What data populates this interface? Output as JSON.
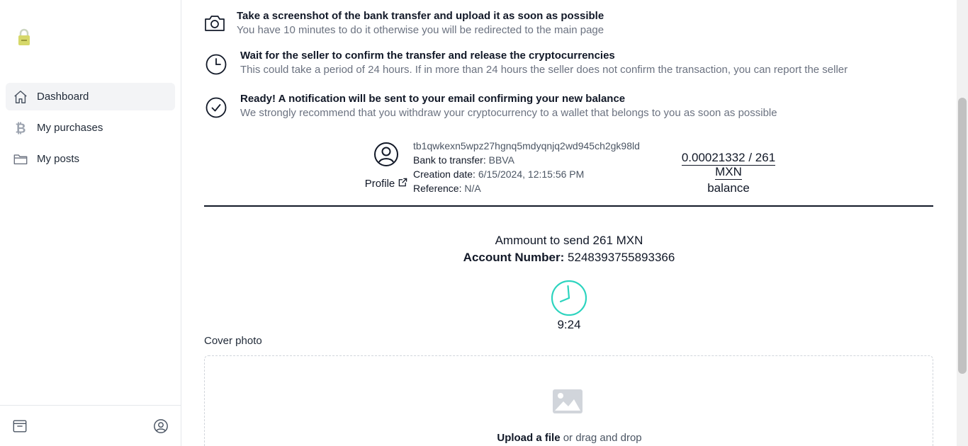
{
  "sidebar": {
    "logo_icon": "padlock-logo",
    "items": [
      {
        "label": "Dashboard",
        "icon": "home-icon",
        "active": true
      },
      {
        "label": "My purchases",
        "icon": "bitcoin-icon",
        "active": false
      },
      {
        "label": "My posts",
        "icon": "folder-icon",
        "active": false
      }
    ],
    "footer": {
      "left_icon": "inbox-icon",
      "right_icon": "user-circle-icon"
    }
  },
  "steps": [
    {
      "icon": "camera-icon",
      "title": "Take a screenshot of the bank transfer and upload it as soon as possible",
      "description": "You have 10 minutes to do it otherwise you will be redirected to the main page"
    },
    {
      "icon": "clock-icon",
      "title": "Wait for the seller to confirm the transfer and release the cryptocurrencies",
      "description": "This could take a period of 24 hours. If in more than 24 hours the seller does not confirm the transaction, you can report the seller"
    },
    {
      "icon": "check-circle-icon",
      "title": "Ready! A notification will be sent to your email confirming your new balance",
      "description": "We strongly recommend that you withdraw your cryptocurrency to a wallet that belongs to you as soon as possible"
    }
  ],
  "order": {
    "profile_label": "Profile",
    "address": "tb1qwkexn5wpz27hgnq5mdyqnjq2wd945ch2gk98ld",
    "bank_label": "Bank to transfer:",
    "bank_value": "BBVA",
    "creation_label": "Creation date:",
    "creation_value": "6/15/2024, 12:15:56 PM",
    "reference_label": "Reference:",
    "reference_value": "N/A",
    "balance_amount": "0.00021332 / 261 MXN",
    "balance_label": "balance"
  },
  "transfer": {
    "amount_text": "Ammount to send 261 MXN",
    "account_label": "Account Number:",
    "account_value": "5248393755893366",
    "timer": "9:24",
    "timer_color": "#2dd4bf"
  },
  "upload": {
    "cover_label": "Cover photo",
    "upload_link": "Upload a file",
    "upload_rest": "or drag and drop"
  }
}
